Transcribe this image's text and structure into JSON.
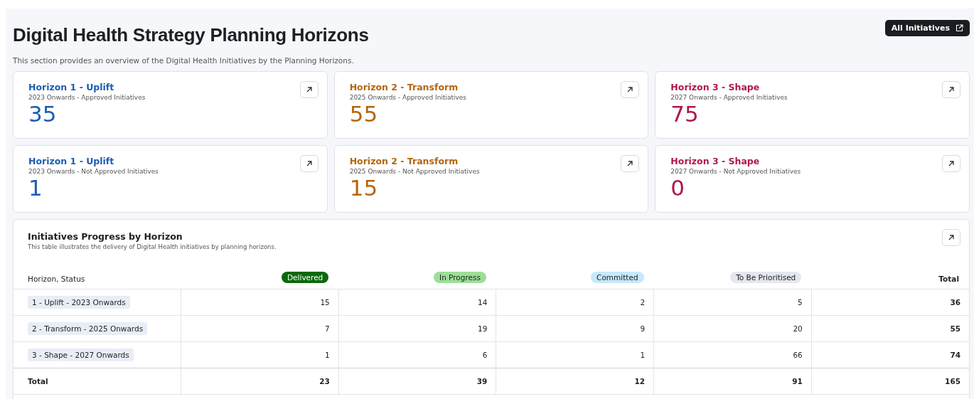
{
  "header": {
    "title": "Digital Health Strategy Planning Horizons",
    "description": "This section provides an overview of the Digital Health Initiatives by the Planning Horizons.",
    "button": "All Initiatives"
  },
  "cards": [
    {
      "title": "Horizon 1 - Uplift",
      "subtitle": "2023 Onwards - Approved Initiatives",
      "value": "35",
      "color": "#1c5db0"
    },
    {
      "title": "Horizon 2 - Transform",
      "subtitle": "2025 Onwards - Approved Initiatives",
      "value": "55",
      "color": "#b5650e"
    },
    {
      "title": "Horizon 3 - Shape",
      "subtitle": "2027 Onwards - Approved Initiatives",
      "value": "75",
      "color": "#b0174a"
    },
    {
      "title": "Horizon 1 - Uplift",
      "subtitle": "2023 Onwards - Not Approved Initiatives",
      "value": "1",
      "color": "#1c5db0"
    },
    {
      "title": "Horizon 2 - Transform",
      "subtitle": "2025 Onwards - Not Approved Initiatives",
      "value": "15",
      "color": "#b5650e"
    },
    {
      "title": "Horizon 3 - Shape",
      "subtitle": "2027 Onwards - Not Approved Initiatives",
      "value": "0",
      "color": "#b0174a"
    }
  ],
  "table_card": {
    "title": "Initiatives Progress by Horizon",
    "description": "This table illustrates the delivery of Digital Health initiatives by planning horizons.",
    "columns": [
      {
        "label": "Horizon, Status",
        "kind": "plain"
      },
      {
        "label": "Delivered",
        "kind": "status",
        "color": "#0b690b"
      },
      {
        "label": "In Progress",
        "kind": "status",
        "color": "#9cdf98"
      },
      {
        "label": "Committed",
        "kind": "status",
        "color": "#c5e9fb"
      },
      {
        "label": "To Be Prioritised",
        "kind": "status",
        "color": "#e3e7ee"
      },
      {
        "label": "Total",
        "kind": "total"
      }
    ],
    "rows": [
      {
        "label": "1 - Uplift - 2023 Onwards",
        "values": [
          "15",
          "14",
          "2",
          "5"
        ],
        "total": "36"
      },
      {
        "label": "2 - Transform - 2025 Onwards",
        "values": [
          "7",
          "19",
          "9",
          "20"
        ],
        "total": "55"
      },
      {
        "label": "3 - Shape - 2027 Onwards",
        "values": [
          "1",
          "6",
          "1",
          "66"
        ],
        "total": "74"
      }
    ],
    "total_row": {
      "label": "Total",
      "values": [
        "23",
        "39",
        "12",
        "91"
      ],
      "total": "165"
    }
  }
}
